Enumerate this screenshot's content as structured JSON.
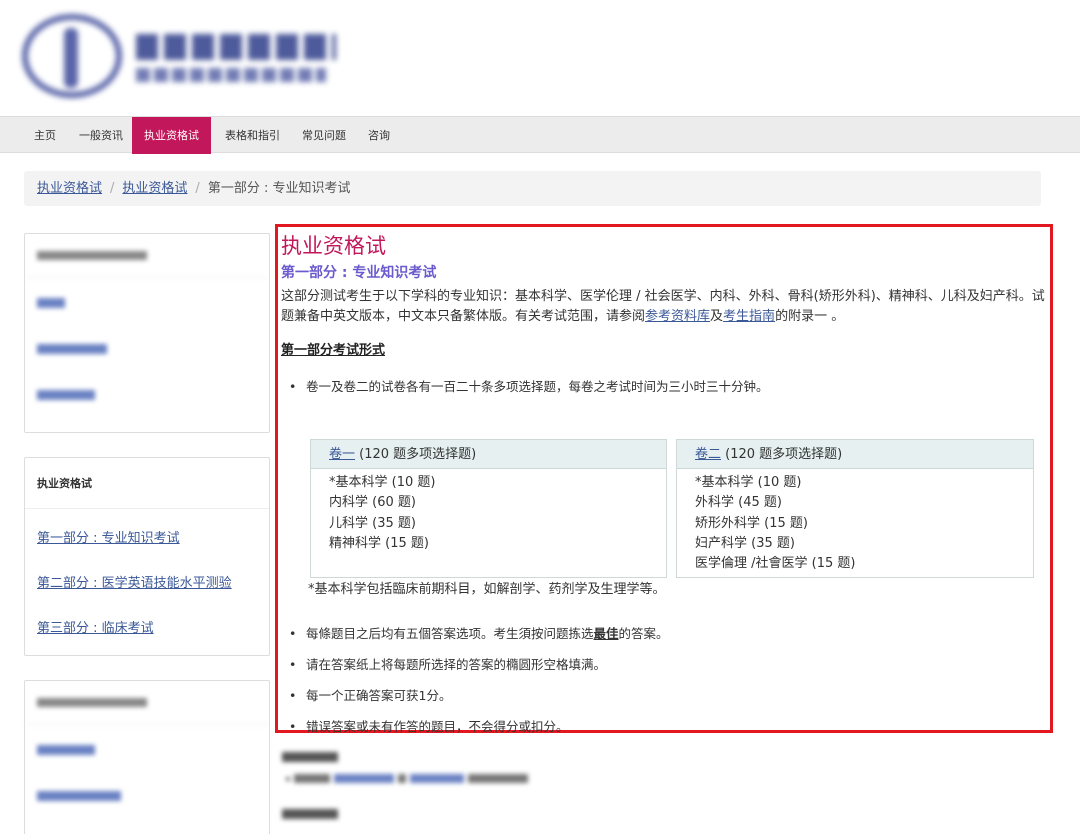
{
  "nav": {
    "items": [
      "主页",
      "一般资讯",
      "执业资格试",
      "表格和指引",
      "常见问题",
      "咨询"
    ],
    "active_index": 2
  },
  "breadcrumb": {
    "items": [
      "执业资格试",
      "执业资格试"
    ],
    "current": "第一部分 : 专业知识考试"
  },
  "sidebar": {
    "box2": {
      "title": "执业资格试",
      "links": [
        "第一部分 : 专业知识考试",
        "第二部分 : 医学英语技能水平测验",
        "第三部分 : 临床考试"
      ]
    }
  },
  "main": {
    "title": "执业资格试",
    "subtitle": "第一部分 : 专业知识考试",
    "intro_text": "这部分测试考生于以下学科的专业知识：基本科学、医学伦理 / 社会医学、内科、外科、骨科(矫形外科)、精神科、儿科及妇产科。试题兼备中英文版本，中文本只备繁体版。有关考试范围，请参阅",
    "intro_link1": "参考资料库",
    "intro_mid": "及",
    "intro_link2": "考生指南",
    "intro_end": "的附录一 。",
    "format_heading": "第一部分考试形式",
    "bullet1": "卷一及卷二的试卷各有一百二十条多项选择题，每卷之考试时间为三小时三十分钟。",
    "paper1": {
      "link": "卷一",
      "header_rest": " (120 题多项选择题)",
      "subjects": [
        "*基本科学 (10 题)",
        "内科学 (60 题)",
        "儿科学 (35 题)",
        "精神科学 (15 题)"
      ]
    },
    "paper2": {
      "link": "卷二",
      "header_rest": " (120 题多项选择题)",
      "subjects": [
        "*基本科学 (10 题)",
        "外科学 (45 题)",
        "矫形外科学 (15 题)",
        "妇产科学 (35 题)",
        "医学倫理 /社會医学 (15 题)"
      ]
    },
    "footnote": "*基本科学包括臨床前期科目，如解剖学、药剂学及生理学等。",
    "bullet2_pre": "每條题目之后均有五個答案选项。考生須按问题拣选",
    "bullet2_bold": "最佳",
    "bullet2_post": "的答案。",
    "bullet3": "请在答案纸上将每题所选择的答案的橢圆形空格填满。",
    "bullet4": "每一个正确答案可获1分。",
    "bullet5": "错误答案或未有作答的题目，不会得分或扣分。"
  },
  "colors": {
    "accent": "#c2185b",
    "highlight_border": "#e3171f",
    "link": "#3b5998",
    "subtitle": "#6a5acd"
  }
}
